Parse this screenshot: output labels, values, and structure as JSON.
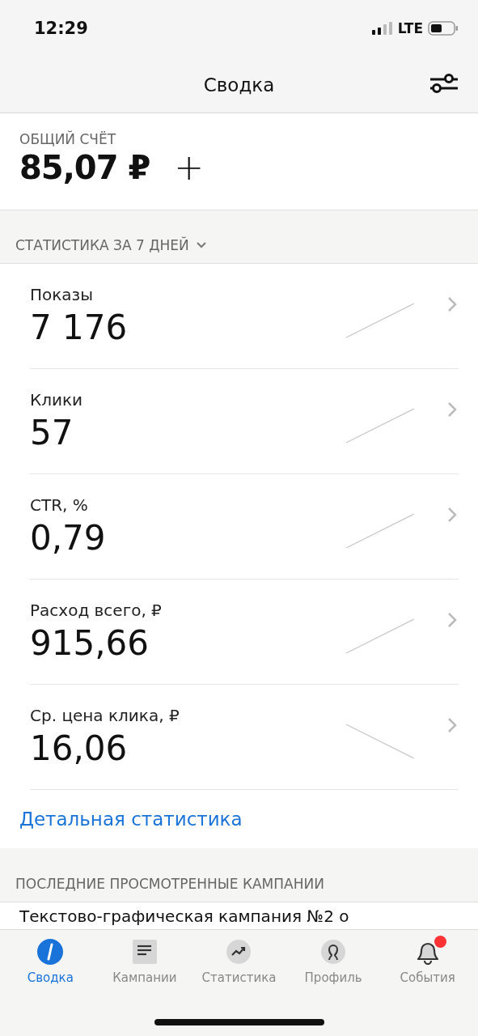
{
  "status_bar": {
    "time": "12:29",
    "network": "LTE"
  },
  "nav": {
    "title": "Сводка"
  },
  "account": {
    "label": "ОБЩИЙ СЧЁТ",
    "balance": "85,07 ₽",
    "add": "+"
  },
  "stats_header": {
    "label": "СТАТИСТИКА ЗА 7 ДНЕЙ"
  },
  "metrics": [
    {
      "label": "Показы",
      "value": "7 176",
      "kind": "rising"
    },
    {
      "label": "Клики",
      "value": "57",
      "kind": "rising"
    },
    {
      "label": "CTR, %",
      "value": "0,79",
      "kind": "rising"
    },
    {
      "label": "Расход всего, ₽",
      "value": "915,66",
      "kind": "rising"
    },
    {
      "label": "Ср. цена клика, ₽",
      "value": "16,06",
      "kind": "falling"
    }
  ],
  "details_link": "Детальная статистика",
  "recent_header": "ПОСЛЕДНИЕ ПРОСМОТРЕННЫЕ КАМПАНИИ",
  "recent_campaigns": [
    {
      "name": "Текстово-графическая кампания №2 о"
    }
  ],
  "tab_bar": [
    {
      "label": "Сводка",
      "kind": "summary",
      "selected": true,
      "badge": false
    },
    {
      "label": "Кампании",
      "kind": "campaigns",
      "selected": false,
      "badge": false
    },
    {
      "label": "Статистика",
      "kind": "stats",
      "selected": false,
      "badge": false
    },
    {
      "label": "Профиль",
      "kind": "profile",
      "selected": false,
      "badge": false
    },
    {
      "label": "События",
      "kind": "events",
      "selected": false,
      "badge": true
    }
  ]
}
